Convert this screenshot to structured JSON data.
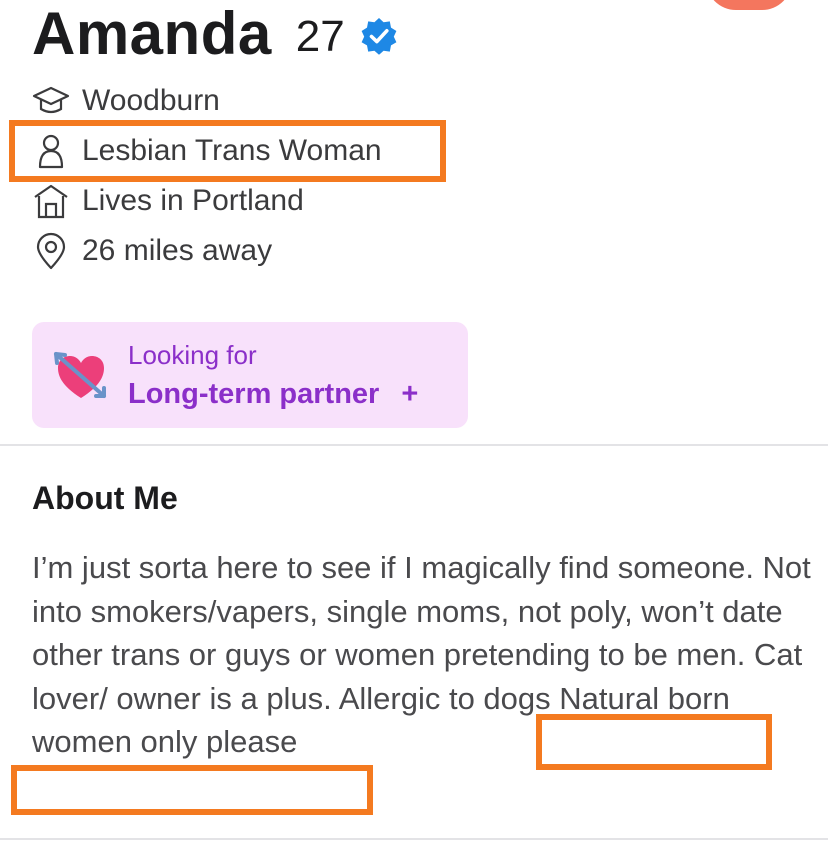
{
  "profile": {
    "name": "Amanda",
    "age": "27",
    "verified_icon": "verified-check-icon",
    "info": [
      {
        "icon": "graduation-cap-icon",
        "text": "Woodburn"
      },
      {
        "icon": "person-outline-icon",
        "text": "Lesbian Trans Woman"
      },
      {
        "icon": "house-icon",
        "text": "Lives in Portland"
      },
      {
        "icon": "location-pin-icon",
        "text": "26 miles away"
      }
    ]
  },
  "looking_for": {
    "icon": "heart-with-arrow-icon",
    "label": "Looking for",
    "value": "Long-term partner",
    "action": "+"
  },
  "about": {
    "title": "About Me",
    "text": "I’m just sorta here to see if I magically find someone. Not into smokers/vapers, single moms, not poly, won’t date other trans or guys or women pretending to be men. Cat lover/ owner is a plus. Allergic to dogs Natural born women only please"
  },
  "colors": {
    "highlight": "#f47a20",
    "accent": "#8b2fc9",
    "card_bg": "#f8e1fb",
    "verified": "#1e88e5"
  }
}
